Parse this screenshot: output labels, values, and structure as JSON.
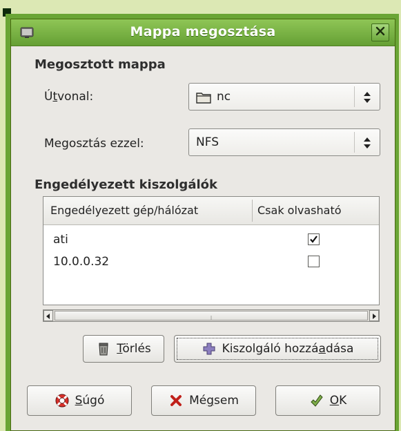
{
  "window": {
    "title": "Mappa megosztása",
    "icon": "folder-share-icon",
    "close_icon": "close-icon"
  },
  "shared_folder": {
    "section_title": "Megosztott mappa",
    "path": {
      "label_pre": "Ú",
      "label_mnemonic": "t",
      "label_post": "vonal:",
      "value": "nc",
      "icon": "folder-icon"
    },
    "share_with": {
      "label": "Megosztás ezzel:",
      "value": "NFS"
    }
  },
  "allowed_hosts": {
    "section_title": "Engedélyezett kiszolgálók",
    "columns": [
      "Engedélyezett gép/hálózat",
      "Csak olvasható"
    ],
    "rows": [
      {
        "host": "ati",
        "read_only": true
      },
      {
        "host": "10.0.0.32",
        "read_only": false
      }
    ],
    "scroll_position": 0
  },
  "buttons": {
    "delete": {
      "mnemonic": "T",
      "rest": "örlés",
      "icon": "trash-icon"
    },
    "add_host": {
      "pre": "Kiszolgáló hozzá",
      "mnemonic": "a",
      "post": "dása",
      "icon": "plus-icon"
    },
    "help": {
      "mnemonic": "S",
      "rest": "úgó",
      "icon": "lifebuoy-icon"
    },
    "cancel": {
      "pre": "Mé",
      "mnemonic": "g",
      "post": "sem",
      "icon": "cancel-x-icon"
    },
    "ok": {
      "mnemonic": "O",
      "rest": "K",
      "icon": "ok-icon"
    }
  },
  "colors": {
    "title_bar": "#7fb548",
    "frame": "#6aa535",
    "background": "#dce8b4"
  }
}
